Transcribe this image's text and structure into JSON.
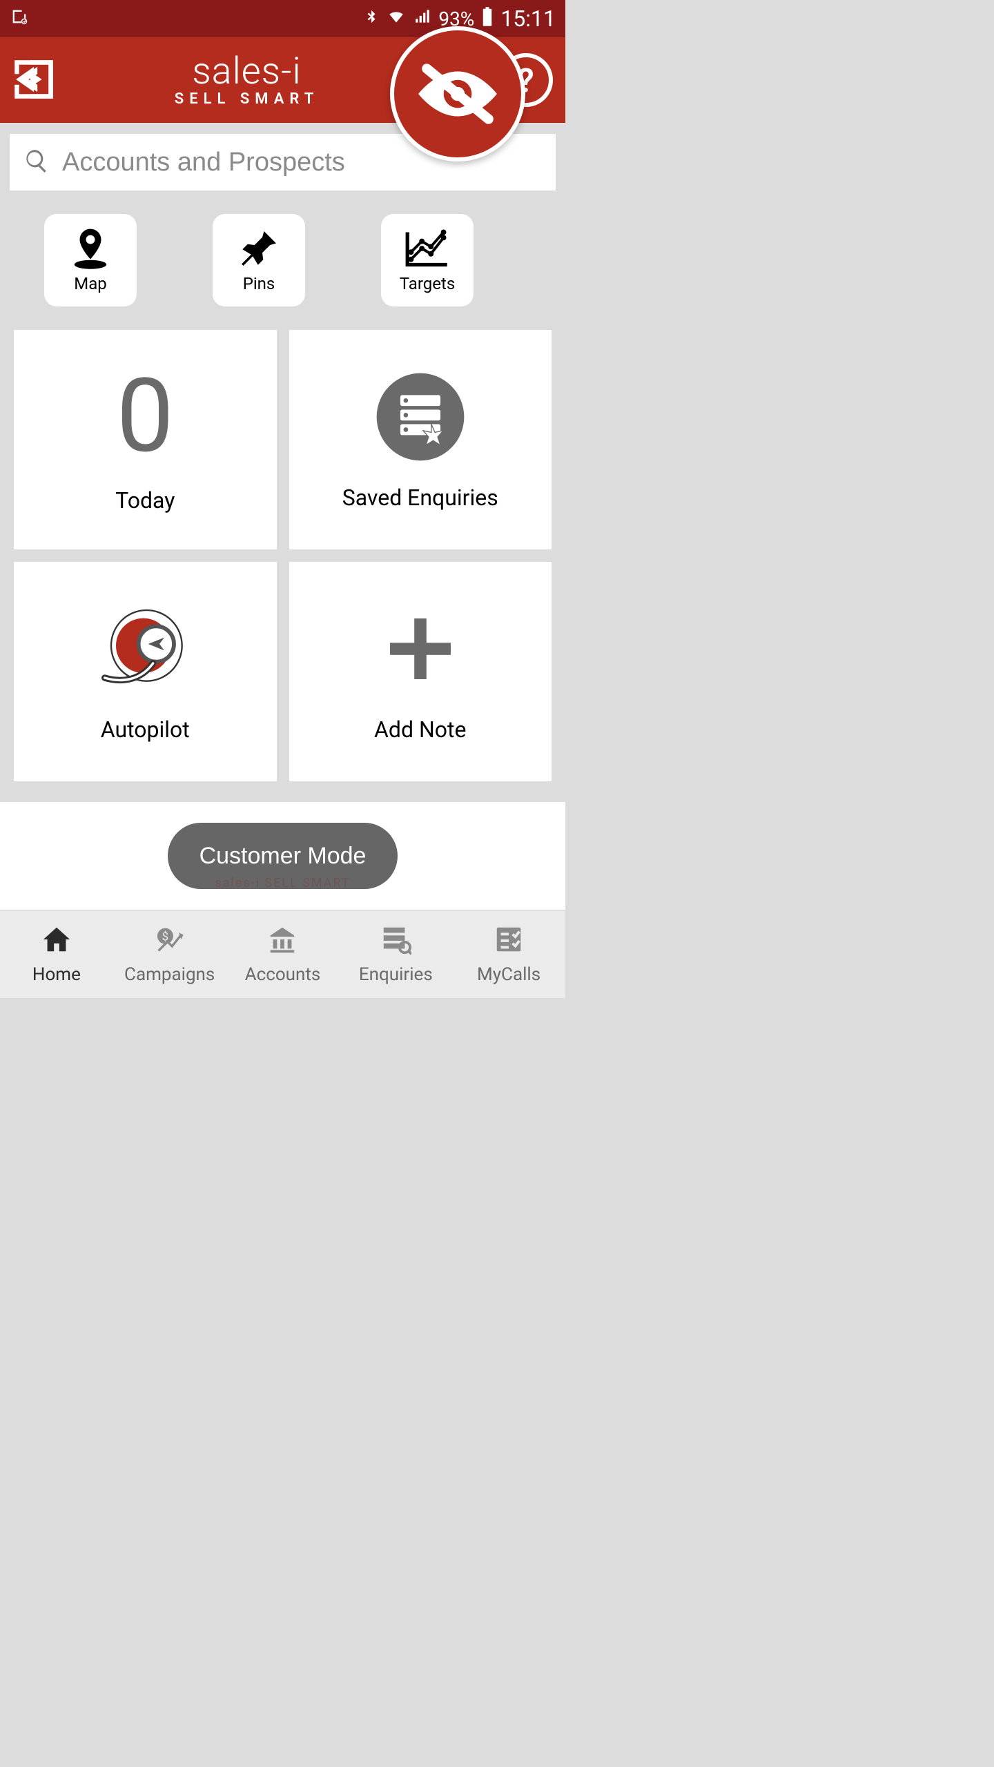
{
  "statusbar": {
    "battery_pct": "93%",
    "time": "15:11"
  },
  "header": {
    "brand_top": "sales-i",
    "brand_sub": "SELL SMART"
  },
  "search": {
    "placeholder": "Accounts and Prospects"
  },
  "actions": {
    "map": "Map",
    "pins": "Pins",
    "targets": "Targets"
  },
  "tiles": {
    "today_count": "0",
    "today_label": "Today",
    "saved_label": "Saved Enquiries",
    "autopilot_label": "Autopilot",
    "addnote_label": "Add Note"
  },
  "mode": {
    "button": "Customer Mode",
    "watermark": "sales-i  SELL SMART"
  },
  "nav": {
    "home": "Home",
    "campaigns": "Campaigns",
    "accounts": "Accounts",
    "enquiries": "Enquiries",
    "mycalls": "MyCalls"
  }
}
